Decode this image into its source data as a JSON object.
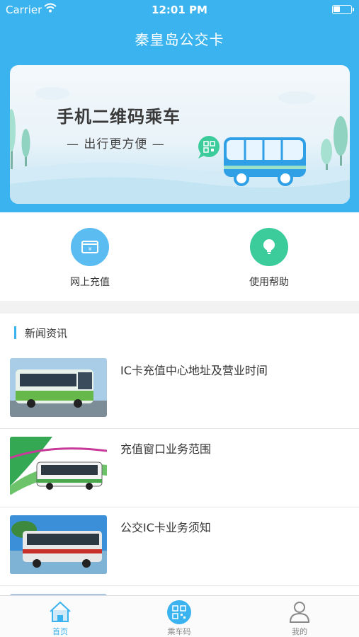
{
  "status_bar": {
    "carrier": "Carrier",
    "time": "12:01 PM"
  },
  "app": {
    "title": "秦皇岛公交卡"
  },
  "banner": {
    "headline": "手机二维码乘车",
    "tagline": "— 出行更方便 —"
  },
  "quick_actions": [
    {
      "label": "网上充值",
      "icon": "wallet-icon",
      "color": "#5bbcf2"
    },
    {
      "label": "使用帮助",
      "icon": "lightbulb-icon",
      "color": "#3ccb9b"
    }
  ],
  "news": {
    "section_title": "新闻资讯",
    "items": [
      {
        "title": "IC卡充值中心地址及营业时间"
      },
      {
        "title": "充值窗口业务范围"
      },
      {
        "title": "公交IC卡业务须知"
      }
    ]
  },
  "tab_bar": {
    "tabs": [
      {
        "label": "首页",
        "icon": "home-icon",
        "active": true
      },
      {
        "label": "乘车码",
        "icon": "qr-code-icon",
        "active": false
      },
      {
        "label": "我的",
        "icon": "user-icon",
        "active": false
      }
    ]
  },
  "colors": {
    "accent": "#3bb3ef",
    "help_green": "#3ccb9b"
  }
}
